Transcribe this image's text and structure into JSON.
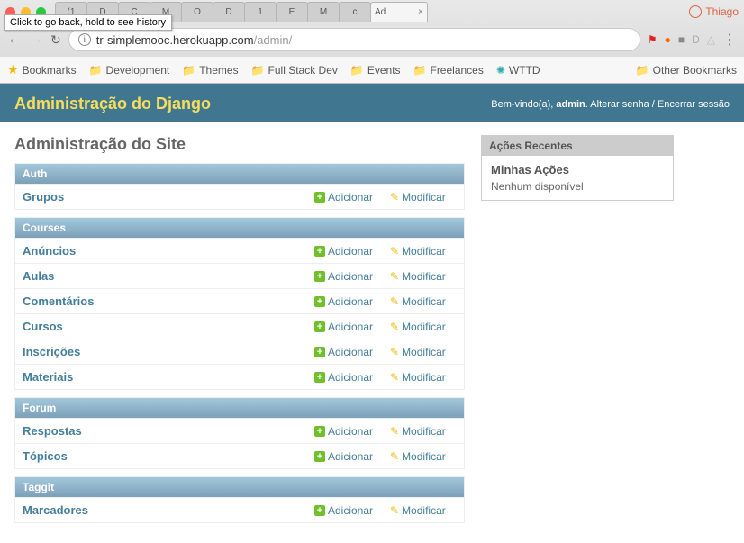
{
  "chrome": {
    "tooltip": "Click to go back, hold to see history",
    "tabs": [
      "(1",
      "D",
      "C",
      "M",
      "O",
      "D",
      "1",
      "E",
      "M",
      "c"
    ],
    "active_tab": "Ad",
    "profile_name": "Thiago",
    "url_host": "tr-simplemooc.herokuapp.com",
    "url_path": "/admin/"
  },
  "bookmarks": {
    "label": "Bookmarks",
    "items": [
      "Development",
      "Themes",
      "Full Stack Dev",
      "Events",
      "Freelances"
    ],
    "wttd": "WTTD",
    "other": "Other Bookmarks"
  },
  "header": {
    "title": "Administração do Django",
    "welcome": "Bem-vindo(a),",
    "user": "admin",
    "change_password": "Alterar senha",
    "logout": "Encerrar sessão"
  },
  "page": {
    "heading": "Administração do Site",
    "add": "Adicionar",
    "change": "Modificar"
  },
  "apps": [
    {
      "name": "Auth",
      "models": [
        "Grupos"
      ]
    },
    {
      "name": "Courses",
      "models": [
        "Anúncios",
        "Aulas",
        "Comentários",
        "Cursos",
        "Inscrições",
        "Materiais"
      ]
    },
    {
      "name": "Forum",
      "models": [
        "Respostas",
        "Tópicos"
      ]
    },
    {
      "name": "Taggit",
      "models": [
        "Marcadores"
      ]
    }
  ],
  "recent": {
    "title": "Ações Recentes",
    "subtitle": "Minhas Ações",
    "empty": "Nenhum disponível"
  }
}
